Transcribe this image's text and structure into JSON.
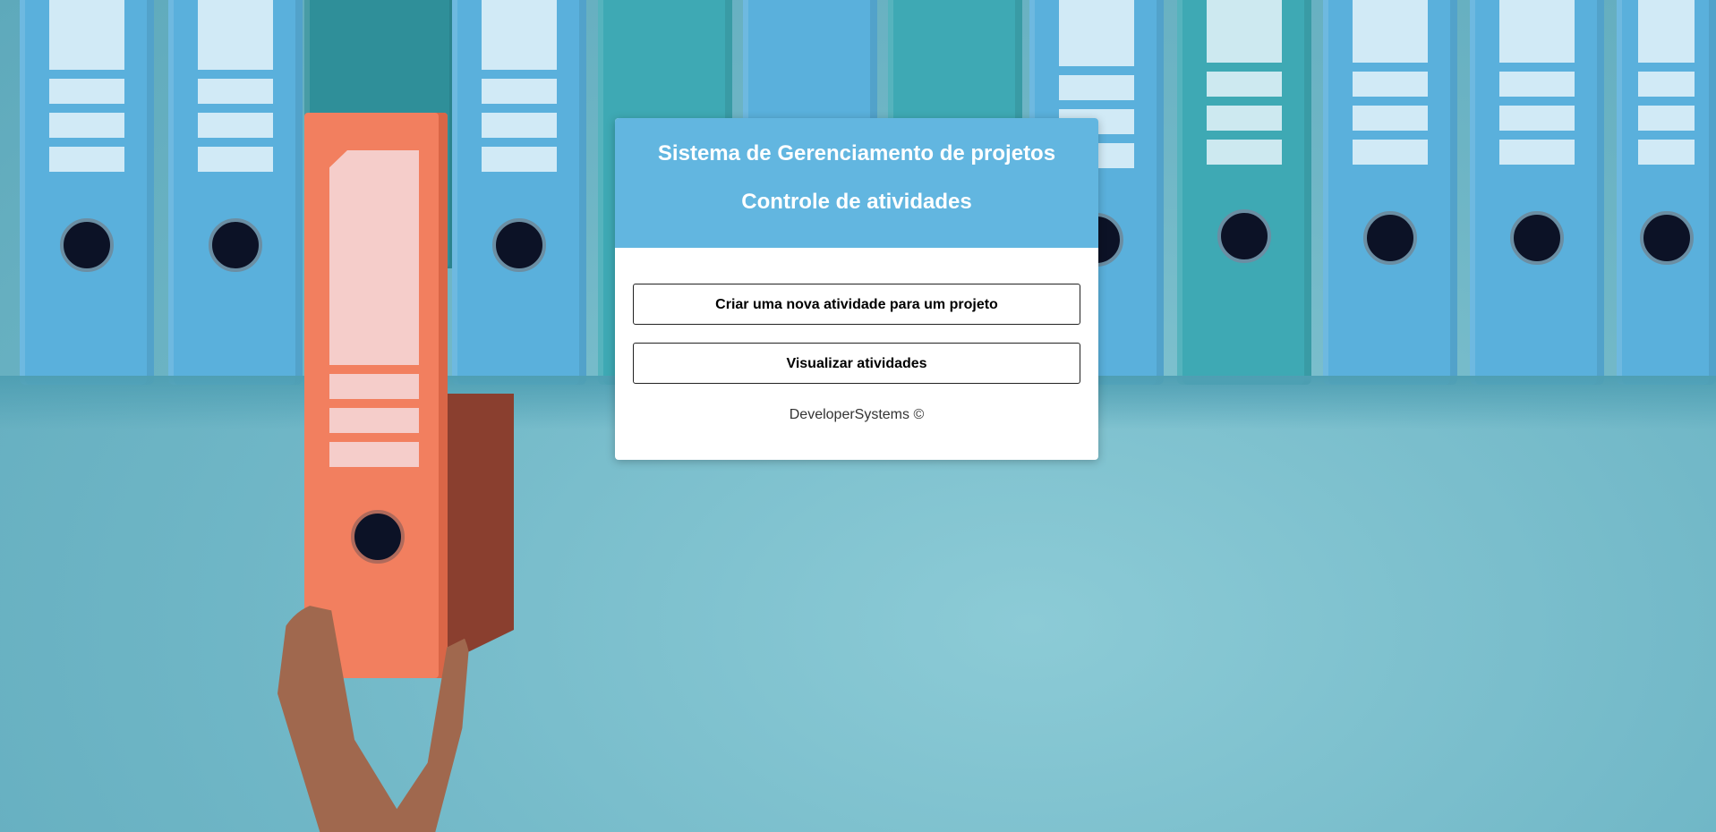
{
  "header": {
    "title": "Sistema de Gerenciamento de projetos",
    "subtitle": "Controle de atividades"
  },
  "actions": {
    "create_label": "Criar uma nova atividade para um projeto",
    "view_label": "Visualizar atividades"
  },
  "footer": {
    "text": "DeveloperSystems ©"
  },
  "colors": {
    "header_bg": "#62b6e0",
    "binder_blue": "#5ab0dc",
    "binder_teal": "#3ea9b4",
    "binder_orange": "#f27f5f"
  }
}
